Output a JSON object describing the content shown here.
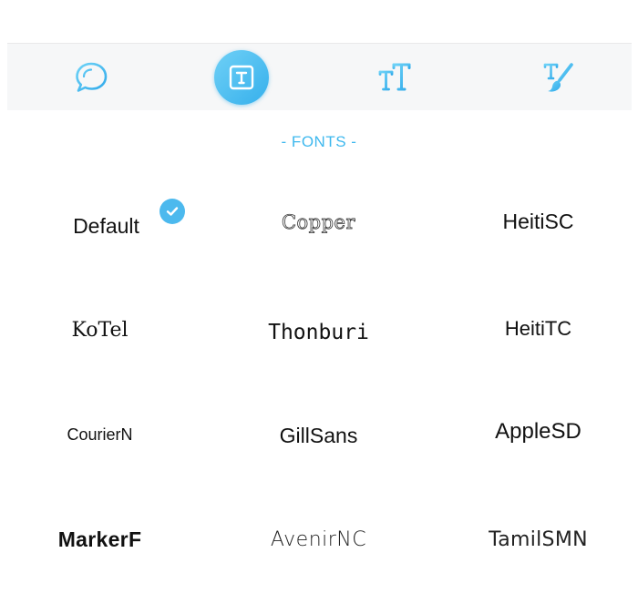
{
  "toolbar": {
    "tools": [
      {
        "name": "speech-bubble",
        "icon": "speech-bubble-icon",
        "active": false
      },
      {
        "name": "text-box",
        "icon": "text-box-icon",
        "active": true
      },
      {
        "name": "text-size",
        "icon": "text-size-icon",
        "active": false
      },
      {
        "name": "text-brush",
        "icon": "text-brush-icon",
        "active": false
      }
    ],
    "accent_color": "#3eb8ee"
  },
  "section": {
    "title": "- FONTS -"
  },
  "fonts": {
    "selected": "Default",
    "items": [
      {
        "label": "Default"
      },
      {
        "label": "Copper"
      },
      {
        "label": "HeitiSC"
      },
      {
        "label": "KoTel"
      },
      {
        "label": "Thonburi"
      },
      {
        "label": "HeitiTC"
      },
      {
        "label": "CourierN"
      },
      {
        "label": "GillSans"
      },
      {
        "label": "AppleSD"
      },
      {
        "label": "MarkerF"
      },
      {
        "label": "AvenirNC"
      },
      {
        "label": "TamilSMN"
      }
    ]
  }
}
